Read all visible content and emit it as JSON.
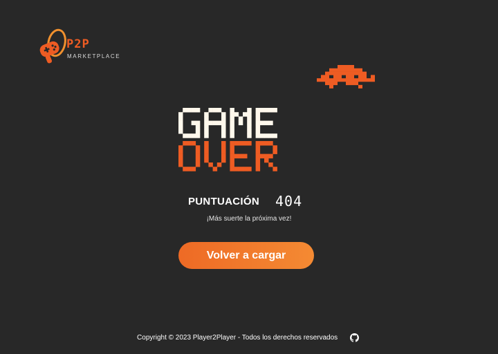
{
  "brand": {
    "name": "P2P",
    "tagline": "MARKETPLACE",
    "logo_icon": "gamepad-ring-logo",
    "accent_color": "#ee5c23"
  },
  "decoration": {
    "invader_icon": "space-invader-icon",
    "invader_color": "#ee5c23"
  },
  "gameover": {
    "line1": "GAME",
    "line2": "OVER",
    "line1_color": "#fff8ec",
    "line2_color": "#ee5c23"
  },
  "score": {
    "label": "PUNTUACIÓN",
    "value": "404"
  },
  "message": "¡Más suerte la próxima vez!",
  "reload_button": {
    "label": "Volver a cargar"
  },
  "footer": {
    "copyright": "Copyright © 2023 Player2Player - Todos los derechos reservados",
    "github_icon": "github-icon"
  }
}
